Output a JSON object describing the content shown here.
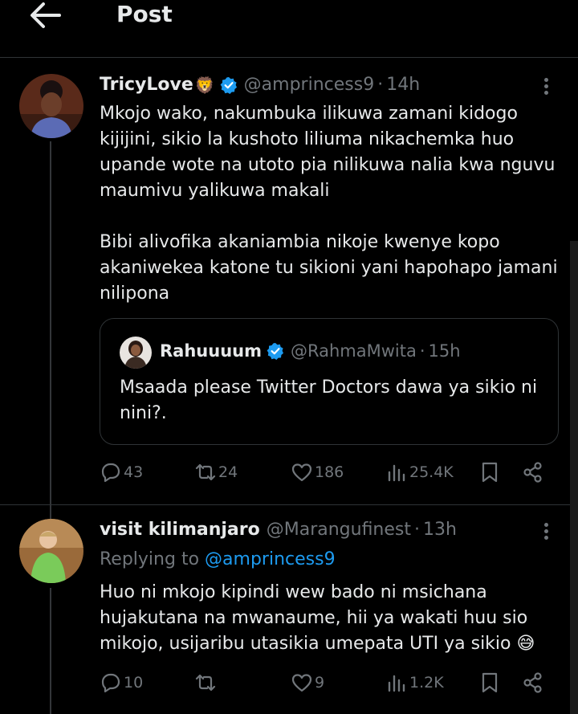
{
  "header": {
    "title": "Post"
  },
  "tweet": {
    "display_name": "TricyLove",
    "name_emoji": "🦁",
    "handle": "@amprincess9",
    "dot": "·",
    "time": "14h",
    "text": "Mkojo wako, nakumbuka ilikuwa zamani kidogo\nkijijini, sikio la kushoto liliuma nikachemka huo\nupande wote na utoto pia nilikuwa nalia kwa nguvu\nmaumivu yalikuwa makali\n\nBibi alivofika akaniambia nikoje kwenye kopo\nakaniwekea katone tu sikioni yani hapohapo jamani\nnilipona",
    "quote": {
      "display_name": "Rahuuuum",
      "handle": "@RahmaMwita",
      "dot": "·",
      "time": "15h",
      "text": "Msaada please Twitter Doctors dawa ya sikio ni nini?."
    },
    "stats": {
      "replies": "43",
      "reposts": "24",
      "likes": "186",
      "views": "25.4K"
    }
  },
  "reply": {
    "display_name": "visit kilimanjaro",
    "handle": "@Marangufinest",
    "dot": "·",
    "time": "13h",
    "replying_to_label": "Replying to",
    "replying_to_handle": "@amprincess9",
    "text": "Huo ni mkojo kipindi wew bado ni msichana\nhujakutana na mwanaume, hii ya wakati huu sio\nmikojo, usijaribu utasikia umepata UTI ya sikio 😅",
    "stats": {
      "replies": "10",
      "reposts": "",
      "likes": "9",
      "views": "1.2K"
    }
  },
  "colors": {
    "background": "#000000",
    "text": "#e7e9ea",
    "muted": "#71767b",
    "accent": "#1d9bf0",
    "border": "#2f3336"
  },
  "icons": [
    "back-arrow-icon",
    "verified-badge-icon",
    "more-icon",
    "reply-icon",
    "repost-icon",
    "like-icon",
    "views-icon",
    "bookmark-icon",
    "share-icon"
  ]
}
